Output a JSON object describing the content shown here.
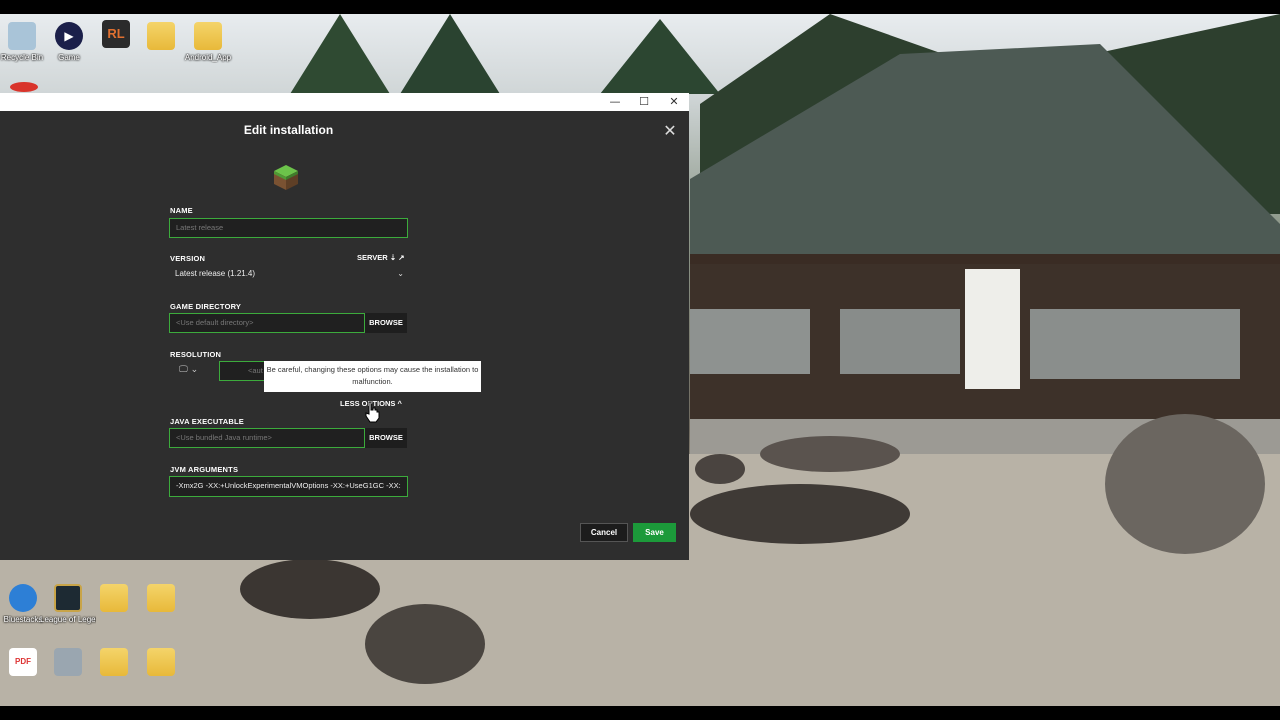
{
  "desktop": {
    "icons_top": [
      {
        "label": "Recycle Bin",
        "icon": "recycle-bin-icon"
      },
      {
        "label": "Game",
        "icon": "play-icon"
      },
      {
        "label": "",
        "icon": "app-rl-icon"
      },
      {
        "label": "",
        "icon": "folder-icon"
      },
      {
        "label": "Android_App",
        "icon": "folder-icon"
      }
    ],
    "icons_bottom_row1": [
      {
        "label": "Bluestacks",
        "icon": "bluestacks-icon"
      },
      {
        "label": "League of Legends",
        "icon": "league-icon"
      },
      {
        "label": "",
        "icon": "folder-icon"
      },
      {
        "label": "",
        "icon": "folder-icon"
      }
    ],
    "icons_bottom_row2": [
      {
        "label": "",
        "icon": "pdf-icon"
      },
      {
        "label": "",
        "icon": "app-icon"
      },
      {
        "label": "",
        "icon": "folder-icon"
      },
      {
        "label": "",
        "icon": "folder-icon"
      }
    ]
  },
  "window": {
    "titlebar": {
      "minimize": "—",
      "maximize": "☐",
      "close": "✕"
    }
  },
  "dialog": {
    "title": "Edit installation",
    "close_glyph": "✕",
    "name_label": "NAME",
    "name_placeholder": "Latest release",
    "version_label": "VERSION",
    "server_label": "SERVER",
    "version_value": "Latest release (1.21.4)",
    "game_dir_label": "GAME DIRECTORY",
    "game_dir_placeholder": "<Use default directory>",
    "browse_label": "BROWSE",
    "resolution_label": "RESOLUTION",
    "resolution_placeholder": "<aut",
    "tooltip": "Be careful, changing these options may cause the installation to malfunction.",
    "less_options": "LESS OPTIONS",
    "java_label": "JAVA EXECUTABLE",
    "java_placeholder": "<Use bundled Java runtime>",
    "jvm_label": "JVM ARGUMENTS",
    "jvm_value": "-Xmx2G -XX:+UnlockExperimentalVMOptions -XX:+UseG1GC -XX:",
    "cancel": "Cancel",
    "save": "Save"
  },
  "colors": {
    "accent_green": "#3cab3c",
    "save_green": "#1c9a3a",
    "dialog_bg": "#2e2e2e"
  }
}
